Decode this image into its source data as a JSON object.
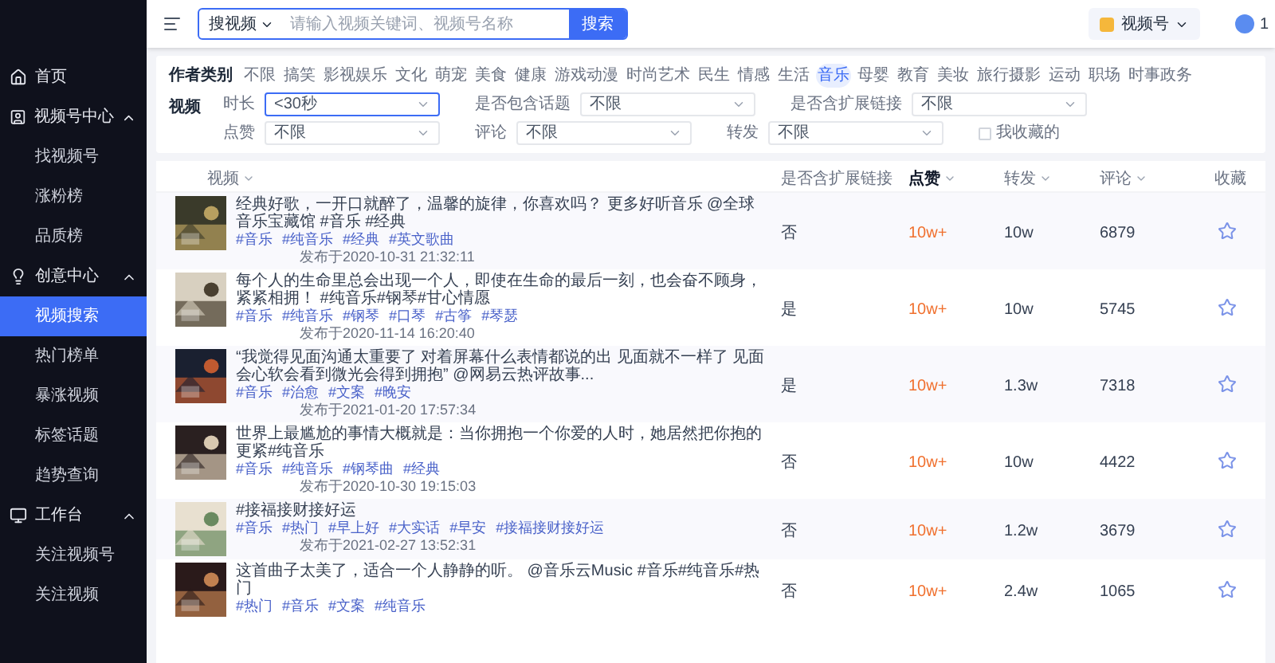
{
  "topbar": {
    "search_type": "搜视频",
    "search_placeholder": "请输入视频关键词、视频号名称",
    "search_button": "搜索",
    "account": "视频号",
    "user_initial": "1"
  },
  "sidebar": {
    "items": [
      {
        "kind": "link",
        "label": "首页",
        "selected": false
      },
      {
        "kind": "group",
        "label": "视频号中心",
        "expanded": true,
        "children": [
          {
            "label": "找视频号",
            "selected": false
          },
          {
            "label": "涨粉榜",
            "selected": false
          },
          {
            "label": "品质榜",
            "selected": false
          }
        ]
      },
      {
        "kind": "group",
        "label": "创意中心",
        "expanded": true,
        "children": [
          {
            "label": "视频搜索",
            "selected": true
          },
          {
            "label": "热门榜单",
            "selected": false
          },
          {
            "label": "暴涨视频",
            "selected": false
          },
          {
            "label": "标签话题",
            "selected": false
          },
          {
            "label": "趋势查询",
            "selected": false
          }
        ]
      },
      {
        "kind": "group",
        "label": "工作台",
        "expanded": true,
        "children": [
          {
            "label": "关注视频号",
            "selected": false
          },
          {
            "label": "关注视频",
            "selected": false
          }
        ]
      }
    ]
  },
  "filters": {
    "category_label": "作者类别",
    "categories": [
      {
        "label": "不限",
        "selected": false
      },
      {
        "label": "搞笑",
        "selected": false
      },
      {
        "label": "影视娱乐",
        "selected": false
      },
      {
        "label": "文化",
        "selected": false
      },
      {
        "label": "萌宠",
        "selected": false
      },
      {
        "label": "美食",
        "selected": false
      },
      {
        "label": "健康",
        "selected": false
      },
      {
        "label": "游戏动漫",
        "selected": false
      },
      {
        "label": "时尚艺术",
        "selected": false
      },
      {
        "label": "民生",
        "selected": false
      },
      {
        "label": "情感",
        "selected": false
      },
      {
        "label": "生活",
        "selected": false
      },
      {
        "label": "音乐",
        "selected": true
      },
      {
        "label": "母婴",
        "selected": false
      },
      {
        "label": "教育",
        "selected": false
      },
      {
        "label": "美妆",
        "selected": false
      },
      {
        "label": "旅行摄影",
        "selected": false
      },
      {
        "label": "运动",
        "selected": false
      },
      {
        "label": "职场",
        "selected": false
      },
      {
        "label": "时事政务",
        "selected": false
      }
    ],
    "video_label": "视频",
    "rows": [
      [
        {
          "kind": "select",
          "label": "时长",
          "value": "<30秒",
          "focused": true
        },
        {
          "kind": "select",
          "label": "是否包含话题",
          "value": "不限",
          "focused": false
        },
        {
          "kind": "select",
          "label": "是否含扩展链接",
          "value": "不限",
          "focused": false
        }
      ],
      [
        {
          "kind": "select",
          "label": "点赞",
          "value": "不限",
          "focused": false
        },
        {
          "kind": "select",
          "label": "评论",
          "value": "不限",
          "focused": false
        },
        {
          "kind": "select",
          "label": "转发",
          "value": "不限",
          "focused": false
        },
        {
          "kind": "checkbox",
          "label": "我收藏的",
          "checked": false
        }
      ]
    ]
  },
  "table": {
    "columns": [
      {
        "label": "视频",
        "sortable": true,
        "selected": false
      },
      {
        "label": "是否含扩展链接",
        "sortable": false,
        "selected": false
      },
      {
        "label": "点赞",
        "sortable": true,
        "selected": true
      },
      {
        "label": "转发",
        "sortable": true,
        "selected": false
      },
      {
        "label": "评论",
        "sortable": true,
        "selected": false
      },
      {
        "label": "收藏",
        "sortable": false,
        "selected": false
      }
    ],
    "rows": [
      {
        "title": "经典好歌，一开口就醉了，温馨的旋律，你喜欢吗？ 更多好听音乐 @全球音乐宝藏馆 #音乐 #经典",
        "tags": [
          "#音乐",
          "#纯音乐",
          "#经典",
          "#英文歌曲"
        ],
        "date": "发布于2020-10-31 21:32:11",
        "link": "否",
        "likes": "10w+",
        "shares": "10w",
        "comments": "6879",
        "favorited": false
      },
      {
        "title": "每个人的生命里总会出现一个人，即使在生命的最后一刻，也会奋不顾身，紧紧相拥！ #纯音乐#钢琴#甘心情愿",
        "tags": [
          "#音乐",
          "#纯音乐",
          "#钢琴",
          "#口琴",
          "#古筝",
          "#琴瑟"
        ],
        "date": "发布于2020-11-14 16:20:40",
        "link": "是",
        "likes": "10w+",
        "shares": "10w",
        "comments": "5745",
        "favorited": false
      },
      {
        "title": "“我觉得见面沟通太重要了 对着屏幕什么表情都说的出 见面就不一样了 见面会心软会看到微光会得到拥抱” @网易云热评故事...",
        "tags": [
          "#音乐",
          "#治愈",
          "#文案",
          "#晚安"
        ],
        "date": "发布于2021-01-20 17:57:34",
        "link": "是",
        "likes": "10w+",
        "shares": "1.3w",
        "comments": "7318",
        "favorited": false
      },
      {
        "title": "世界上最尴尬的事情大概就是：当你拥抱一个你爱的人时，她居然把你抱的更紧#纯音乐",
        "tags": [
          "#音乐",
          "#纯音乐",
          "#钢琴曲",
          "#经典"
        ],
        "date": "发布于2020-10-30 19:15:03",
        "link": "否",
        "likes": "10w+",
        "shares": "10w",
        "comments": "4422",
        "favorited": false
      },
      {
        "title": "#接福接财接好运",
        "tags": [
          "#音乐",
          "#热门",
          "#早上好",
          "#大实话",
          "#早安",
          "#接福接财接好运"
        ],
        "date": "发布于2021-02-27 13:52:31",
        "link": "否",
        "likes": "10w+",
        "shares": "1.2w",
        "comments": "3679",
        "favorited": false
      },
      {
        "title": "这首曲子太美了，适合一个人静静的听。 @音乐云Music #音乐#纯音乐#热门",
        "tags": [
          "#热门",
          "#音乐",
          "#文案",
          "#纯音乐"
        ],
        "link": "否",
        "likes": "10w+",
        "shares": "2.4w",
        "comments": "1065",
        "favorited": false
      }
    ]
  }
}
